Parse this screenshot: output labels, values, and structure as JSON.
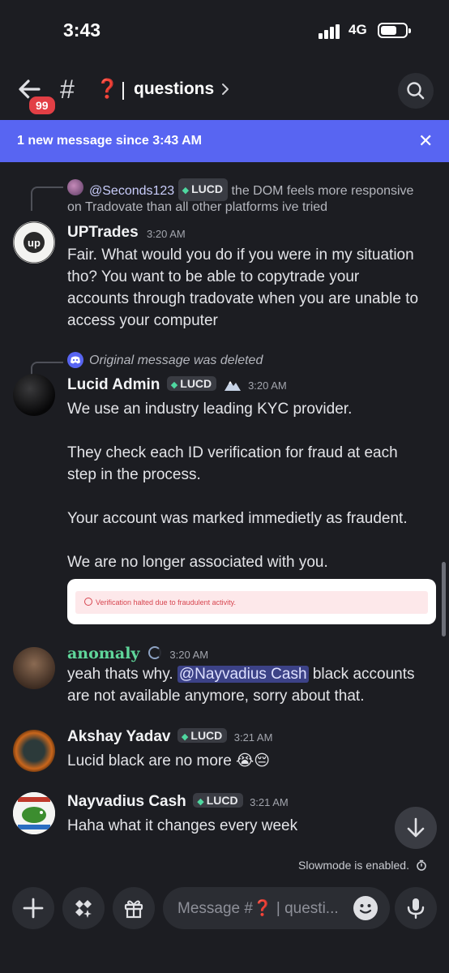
{
  "status_bar": {
    "time": "3:43",
    "network": "4G"
  },
  "header": {
    "unread_count": "99",
    "channel_hash": "#",
    "channel_emoji": "❓",
    "separator": "|",
    "channel_name": "questions"
  },
  "banner": {
    "text": "1 new message since 3:43 AM",
    "close": "✕"
  },
  "messages": [
    {
      "reply": {
        "mention": "@Seconds123",
        "tag": "LUCD",
        "text_line1": "the DOM feels more responsive",
        "text_line2": "on Tradovate than all other platforms ive tried"
      },
      "username": "UPTrades",
      "time": "3:20 AM",
      "lines": [
        "Fair. What would you do if you were in my situation",
        "tho? You want to be able to copytrade your",
        "accounts through tradovate when you are unable to",
        "access your computer"
      ]
    },
    {
      "reply": {
        "deleted": "Original message was deleted"
      },
      "username": "Lucid Admin",
      "tag": "LUCD",
      "time": "3:20 AM",
      "lines": [
        "We use an industry leading KYC provider.",
        "They check each ID verification for fraud at each",
        "step in the process.",
        "Your account was marked immedietly as fraudent.",
        "We are no longer associated with you."
      ],
      "embed_text": "Verification halted due to fraudulent activity."
    },
    {
      "username": "anomaly",
      "time": "3:20 AM",
      "mention": "@Nayvadius Cash",
      "line1_start": "yeah thats why.",
      "line1_end": "black accounts",
      "line2": "are not available anymore, sorry about that."
    },
    {
      "username": "Akshay Yadav",
      "tag": "LUCD",
      "time": "3:21 AM",
      "text": "Lucid black are no more 😭😔"
    },
    {
      "username": "Nayvadius Cash",
      "tag": "LUCD",
      "time": "3:21 AM",
      "text": "Haha what it changes every week"
    }
  ],
  "footer": {
    "slowmode": "Slowmode is enabled.",
    "placeholder": "Message #❓ | questi..."
  },
  "colors": {
    "accent": "#5865f2",
    "anomaly_name": "#5fd69a",
    "badge": "#e23f45"
  }
}
